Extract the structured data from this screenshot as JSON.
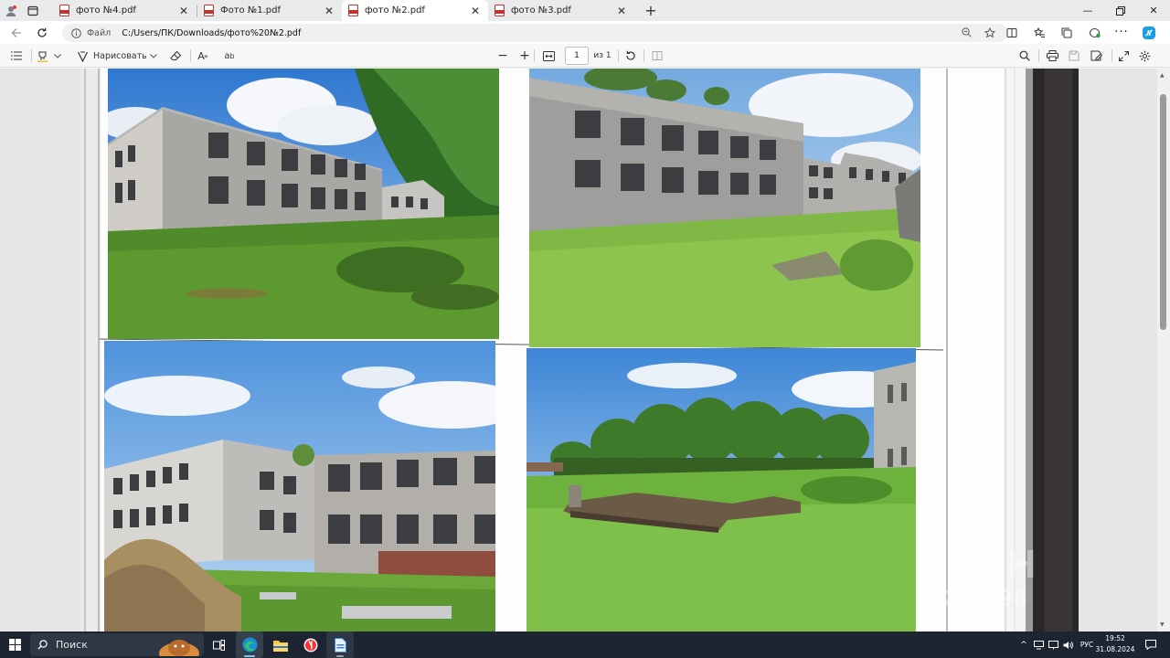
{
  "browser": {
    "tabs": [
      {
        "label": "фото №4.pdf",
        "active": false
      },
      {
        "label": "Фото №1.pdf",
        "active": false
      },
      {
        "label": "фото №2.pdf",
        "active": true
      },
      {
        "label": "фото №3.pdf",
        "active": false
      }
    ],
    "file_label": "Файл",
    "url": "C:/Users/ПК/Downloads/фото%20№2.pdf"
  },
  "pdf_toolbar": {
    "draw_label": "Нарисовать",
    "page_current": "1",
    "page_total_label": "из 1"
  },
  "document": {
    "watermark_text": "ЦИАН",
    "watermark_digits": "5250598"
  },
  "taskbar": {
    "search_label": "Поиск",
    "lang": "РУС",
    "time": "19:52",
    "date": "31.08.2024"
  },
  "colors": {
    "accent": "#0b5cad",
    "tab_strip": "#e9eaec",
    "taskbar": "#1c2531",
    "pdf_icon": "#c8322b"
  }
}
